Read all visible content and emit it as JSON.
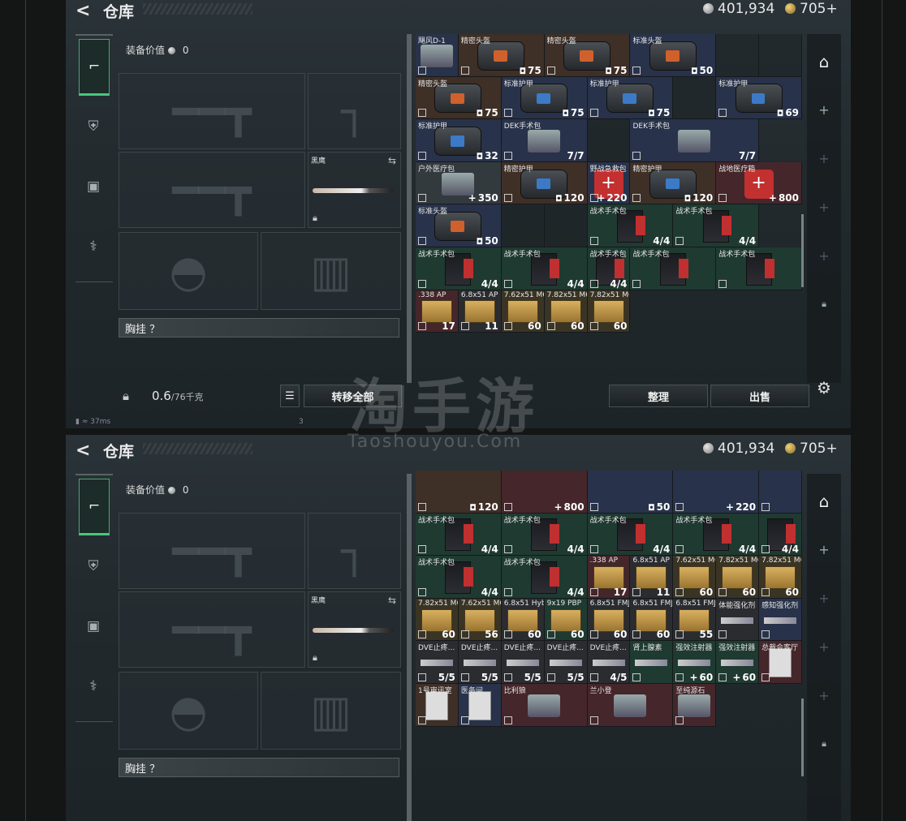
{
  "header": {
    "back": "<",
    "title": "仓库",
    "silver": "401,934",
    "gold": "705+"
  },
  "equip": {
    "value_label": "装备价值",
    "value": "0",
    "melee_name": "黑鹰",
    "chest_label": "胸挂 ？"
  },
  "bottom": {
    "weight": "0.6",
    "weight_max": "/76千克",
    "transfer_all": "转移全部",
    "sort": "整理",
    "sell": "出售"
  },
  "status": {
    "ping": "37ms",
    "page": "3"
  },
  "watermark": {
    "cn": "淘手游",
    "en": "Taoshouyou.Com"
  },
  "top_grid": [
    {
      "name": "飓风D-1",
      "count": "",
      "kind": "blue",
      "pic": "tile"
    },
    {
      "name": "精密头盔",
      "count": "75",
      "kind": "brown",
      "pic": "bag orange",
      "span": 2,
      "badge": "shield"
    },
    {
      "name": "精密头盔",
      "count": "75",
      "kind": "brown",
      "pic": "bag orange",
      "span": 2,
      "badge": "shield"
    },
    {
      "name": "标准头盔",
      "count": "50",
      "kind": "blue",
      "pic": "bag orange",
      "span": 2,
      "badge": "shield"
    },
    {
      "name": "",
      "count": "",
      "kind": "empty",
      "pic": ""
    },
    {
      "name": "",
      "count": "",
      "kind": "empty",
      "pic": ""
    },
    {
      "name": "精密头盔",
      "count": "75",
      "kind": "brown",
      "pic": "bag orange",
      "span": 2,
      "badge": "shield"
    },
    {
      "name": "标准护甲",
      "count": "75",
      "kind": "blue",
      "pic": "bag",
      "span": 2,
      "badge": "shield"
    },
    {
      "name": "标准护甲",
      "count": "75",
      "kind": "blue",
      "pic": "bag",
      "span": 2,
      "badge": "shield"
    },
    {
      "name": "",
      "count": "",
      "kind": "empty",
      "pic": ""
    },
    {
      "name": "标准护甲",
      "count": "69",
      "kind": "blue",
      "pic": "bag",
      "span": 2,
      "badge": "shield"
    },
    {
      "name": "标准护甲",
      "count": "32",
      "kind": "blue",
      "pic": "bag",
      "span": 2,
      "badge": "shield"
    },
    {
      "name": "DEK手术包",
      "count": "7/7",
      "kind": "blue",
      "pic": "tile",
      "span": 2
    },
    {
      "name": "",
      "count": "",
      "kind": "empty",
      "pic": ""
    },
    {
      "name": "DEK手术包",
      "count": "7/7",
      "kind": "blue",
      "pic": "tile",
      "span": 3
    },
    {
      "name": "户外医疗包",
      "count": "350",
      "kind": "gray",
      "pic": "tile",
      "span": 2,
      "badge": "plus"
    },
    {
      "name": "精密护甲",
      "count": "120",
      "kind": "brown",
      "pic": "bag",
      "span": 2,
      "badge": "shield"
    },
    {
      "name": "野战急救包",
      "count": "220",
      "kind": "blue",
      "pic": "medkit",
      "span": 1,
      "badge": "plus"
    },
    {
      "name": "精密护甲",
      "count": "120",
      "kind": "brown",
      "pic": "bag",
      "span": 2,
      "badge": "shield"
    },
    {
      "name": "战地医疗箱",
      "count": "800",
      "kind": "red",
      "pic": "medkit",
      "span": 2,
      "badge": "plus"
    },
    {
      "name": "标准头盔",
      "count": "50",
      "kind": "blue",
      "pic": "bag orange",
      "span": 2,
      "badge": "shield"
    },
    {
      "name": "",
      "count": "",
      "kind": "empty",
      "pic": ""
    },
    {
      "name": "",
      "count": "",
      "kind": "empty",
      "pic": ""
    },
    {
      "name": "战术手术包",
      "count": "4/4",
      "kind": "green",
      "pic": "pouch",
      "span": 2
    },
    {
      "name": "战术手术包",
      "count": "4/4",
      "kind": "green",
      "pic": "pouch",
      "span": 2
    },
    {
      "name": "战术手术包",
      "count": "4/4",
      "kind": "green",
      "pic": "pouch",
      "span": 2
    },
    {
      "name": "战术手术包",
      "count": "4/4",
      "kind": "green",
      "pic": "pouch",
      "span": 2
    },
    {
      "name": "战术手术包",
      "count": "4/4",
      "kind": "green",
      "pic": "pouch",
      "span": 1
    },
    {
      "name": "战术手术包",
      "count": "",
      "kind": "green",
      "pic": "pouch",
      "span": 2
    },
    {
      "name": "战术手术包",
      "count": "",
      "kind": "green",
      "pic": "pouch",
      "span": 2
    },
    {
      "name": ".338 AP",
      "count": "17",
      "kind": "red",
      "pic": "box",
      "span": 1
    },
    {
      "name": "6.8x51 AP",
      "count": "11",
      "kind": "dark",
      "pic": "box",
      "span": 1
    },
    {
      "name": "7.62x51 M62",
      "count": "60",
      "kind": "ammo",
      "pic": "box",
      "span": 1
    },
    {
      "name": "7.82x51 M62",
      "count": "60",
      "kind": "ammo",
      "pic": "box",
      "span": 1
    },
    {
      "name": "7.82x51 M62",
      "count": "60",
      "kind": "ammo",
      "pic": "box",
      "span": 1
    }
  ],
  "bottom_grid": [
    {
      "name": "",
      "count": "120",
      "kind": "brown",
      "pic": "",
      "span": 2,
      "badge": "shield"
    },
    {
      "name": "",
      "count": "800",
      "kind": "red",
      "pic": "",
      "span": 2,
      "badge": "plus"
    },
    {
      "name": "",
      "count": "50",
      "kind": "blue",
      "pic": "",
      "span": 2,
      "badge": "shield"
    },
    {
      "name": "",
      "count": "220",
      "kind": "blue",
      "pic": "",
      "span": 2,
      "badge": "plus"
    },
    {
      "name": "",
      "count": "",
      "kind": "blue",
      "pic": "",
      "span": 1
    },
    {
      "name": "战术手术包",
      "count": "4/4",
      "kind": "green",
      "pic": "pouch",
      "span": 2
    },
    {
      "name": "战术手术包",
      "count": "4/4",
      "kind": "green",
      "pic": "pouch",
      "span": 2
    },
    {
      "name": "战术手术包",
      "count": "4/4",
      "kind": "green",
      "pic": "pouch",
      "span": 2
    },
    {
      "name": "战术手术包",
      "count": "4/4",
      "kind": "green",
      "pic": "pouch",
      "span": 2
    },
    {
      "name": "",
      "count": "4/4",
      "kind": "green",
      "pic": "pouch",
      "span": 1
    },
    {
      "name": "战术手术包",
      "count": "4/4",
      "kind": "green",
      "pic": "pouch",
      "span": 2
    },
    {
      "name": "战术手术包",
      "count": "4/4",
      "kind": "green",
      "pic": "pouch",
      "span": 2
    },
    {
      "name": ".338 AP",
      "count": "17",
      "kind": "red",
      "pic": "box",
      "span": 1
    },
    {
      "name": "6.8x51 AP",
      "count": "11",
      "kind": "dark",
      "pic": "box",
      "span": 1
    },
    {
      "name": "7.62x51 M62",
      "count": "60",
      "kind": "ammo",
      "pic": "box",
      "span": 1
    },
    {
      "name": "7.82x51 M62",
      "count": "60",
      "kind": "ammo",
      "pic": "box",
      "span": 1
    },
    {
      "name": "7.82x51 M62",
      "count": "60",
      "kind": "ammo",
      "pic": "box",
      "span": 1
    },
    {
      "name": "7.82x51 M62",
      "count": "60",
      "kind": "ammo",
      "pic": "box",
      "span": 1
    },
    {
      "name": "7.62x51 M61",
      "count": "56",
      "kind": "ammo",
      "pic": "box",
      "span": 1
    },
    {
      "name": "6.8x51 Hybrid",
      "count": "60",
      "kind": "dark",
      "pic": "box",
      "span": 1
    },
    {
      "name": "9x19 PBP",
      "count": "60",
      "kind": "green",
      "pic": "box",
      "span": 1
    },
    {
      "name": "6.8x51 FMJ",
      "count": "60",
      "kind": "dark",
      "pic": "box",
      "span": 1
    },
    {
      "name": "6.8x51 FMJ",
      "count": "60",
      "kind": "dark",
      "pic": "box",
      "span": 1
    },
    {
      "name": "6.8x51 FMJ",
      "count": "55",
      "kind": "dark",
      "pic": "box",
      "span": 1
    },
    {
      "name": "体能强化剂",
      "count": "",
      "kind": "dark",
      "pic": "inj",
      "span": 1
    },
    {
      "name": "感知强化剂",
      "count": "",
      "kind": "blue",
      "pic": "inj",
      "span": 1
    },
    {
      "name": "DVE止疼...",
      "count": "5/5",
      "kind": "dark",
      "pic": "inj",
      "span": 1
    },
    {
      "name": "DVE止疼...",
      "count": "5/5",
      "kind": "dark",
      "pic": "inj",
      "span": 1
    },
    {
      "name": "DVE止疼...",
      "count": "5/5",
      "kind": "dark",
      "pic": "inj",
      "span": 1
    },
    {
      "name": "DVE止疼...",
      "count": "5/5",
      "kind": "dark",
      "pic": "inj",
      "span": 1
    },
    {
      "name": "DVE止疼...",
      "count": "4/5",
      "kind": "dark",
      "pic": "inj",
      "span": 1
    },
    {
      "name": "肾上腺素",
      "count": "",
      "kind": "green",
      "pic": "inj",
      "span": 1
    },
    {
      "name": "强效注射器",
      "count": "60",
      "kind": "green",
      "pic": "inj",
      "span": 1,
      "badge": "plus"
    },
    {
      "name": "强效注射器",
      "count": "60",
      "kind": "green",
      "pic": "inj",
      "span": 1,
      "badge": "plus"
    },
    {
      "name": "总裁会客厅",
      "count": "",
      "kind": "red",
      "pic": "card",
      "span": 1
    },
    {
      "name": "1号审讯室",
      "count": "",
      "kind": "brown",
      "pic": "card",
      "span": 1
    },
    {
      "name": "医务间",
      "count": "",
      "kind": "blue",
      "pic": "card",
      "span": 1
    },
    {
      "name": "比利狼",
      "count": "",
      "kind": "red",
      "pic": "tile",
      "span": 2
    },
    {
      "name": "兰小登",
      "count": "",
      "kind": "red",
      "pic": "tile",
      "span": 2
    },
    {
      "name": "至纯源石",
      "count": "",
      "kind": "red",
      "pic": "tile",
      "span": 1
    }
  ]
}
